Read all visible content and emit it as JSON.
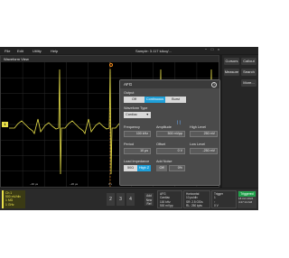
{
  "menu": {
    "items": [
      "File",
      "Edit",
      "Utility",
      "Help"
    ]
  },
  "status": {
    "sample": "Sample: 3.117 kAcq/..."
  },
  "window_controls": [
    "−",
    "□",
    "×"
  ],
  "right_panel": {
    "cursors": "Cursors",
    "callout": "Callout",
    "measure": "Measure",
    "search": "Search",
    "more": "More..."
  },
  "waveform_view": {
    "title": "Waveform View",
    "channel_marker": "1",
    "time_labels": [
      "−40 µs",
      "−20 µs",
      "0 s",
      "20 µs",
      "40 µs"
    ]
  },
  "dialog": {
    "title": "AFG",
    "help": "?",
    "output": {
      "label": "Output",
      "options": [
        "Off",
        "Continuous",
        "Burst"
      ],
      "selected": 1
    },
    "waveform_type": {
      "label": "Waveform Type",
      "value": "Cardiac"
    },
    "frequency": {
      "label": "Frequency",
      "value": "100 kHz"
    },
    "amplitude": {
      "label": "Amplitude",
      "value": "500 mVpp"
    },
    "high_level": {
      "label": "High Level",
      "value": "250 mV"
    },
    "period": {
      "label": "Period",
      "value": "10 µs"
    },
    "offset": {
      "label": "Offset",
      "value": "0 V"
    },
    "low_level": {
      "label": "Low Level",
      "value": "-250 mV"
    },
    "load_impedance": {
      "label": "Load Impedance",
      "options": [
        "50Ω",
        "High Z"
      ],
      "selected": 1
    },
    "add_noise": {
      "label": "Add Noise",
      "toggle": "Off",
      "value": "0%"
    }
  },
  "bottom": {
    "ch1": {
      "title": "Ch 1",
      "lines": [
        "500 mV/div",
        "1 MΩ",
        "1 GHz"
      ]
    },
    "channels": [
      "2",
      "3",
      "4"
    ],
    "new_ref": [
      "Add",
      "New",
      "Ref"
    ],
    "afg": {
      "title": "AFG",
      "lines": [
        "Cardiac",
        "100 kHz",
        "500 mVpp",
        "0 V offset"
      ]
    },
    "horizontal": {
      "title": "Horizontal",
      "lines": [
        "10 µs/div",
        "100 µs",
        "SR: 2.5 GS/s",
        "RL: 250 kpts"
      ]
    },
    "trigger": {
      "title": "Trigger",
      "lines": [
        "1",
        "↑",
        "0 V"
      ]
    },
    "trigger_status": {
      "badge": "Triggered",
      "lines": [
        "18 Oct 2024",
        "4:27:14 AM"
      ]
    }
  },
  "colors": {
    "ch1": "#e8e04a",
    "trigger": "#f08a1c",
    "accent": "#1e9fd8",
    "triggered": "#21a04a"
  }
}
